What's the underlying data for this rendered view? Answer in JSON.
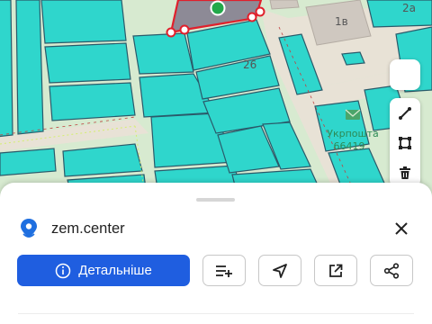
{
  "map": {
    "parcel_labels": [
      "1в",
      "2а",
      "26"
    ],
    "poi_label": "Укрпошта",
    "poi_label_2": "66419"
  },
  "colors": {
    "parcel_fill": "#2fd6cc",
    "parcel_border": "#2a5a6a",
    "selected_fill": "#8d8a96",
    "selected_border": "#e0202c",
    "marker": "#22a84a",
    "road": "#e8e2d6",
    "primary_button": "#1f5ee0"
  },
  "sheet": {
    "site_name": "zem.center",
    "primary_label": "Детальніше",
    "action_icons": [
      "add-to-list-icon",
      "navigate-icon",
      "open-external-icon",
      "share-icon"
    ]
  },
  "side_tools": [
    "blank-tool",
    "line-tool-icon",
    "polygon-tool-icon",
    "trash-icon"
  ]
}
